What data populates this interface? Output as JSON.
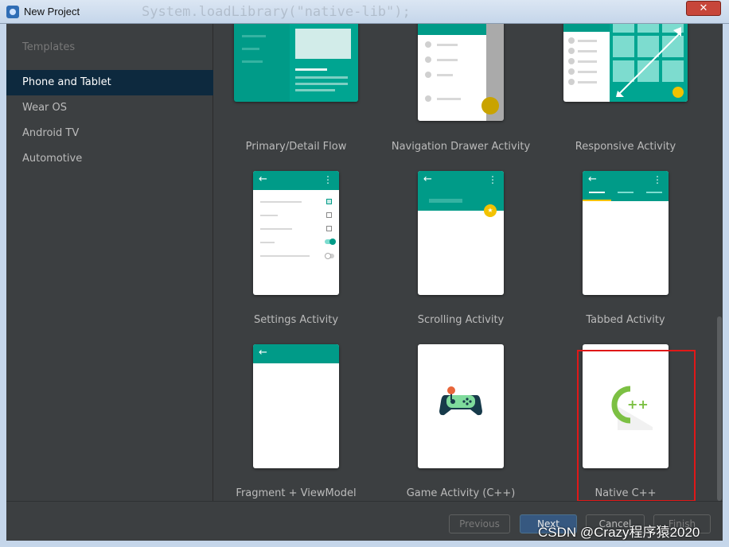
{
  "window": {
    "title": "New Project",
    "background_code_text": "System.loadLibrary(\"native-lib\");",
    "close_glyph": "✕"
  },
  "sidebar": {
    "heading": "Templates",
    "items": [
      {
        "label": "Phone and Tablet",
        "selected": true
      },
      {
        "label": "Wear OS",
        "selected": false
      },
      {
        "label": "Android TV",
        "selected": false
      },
      {
        "label": "Automotive",
        "selected": false
      }
    ]
  },
  "templates": [
    {
      "label": "Primary/Detail Flow"
    },
    {
      "label": "Navigation Drawer Activity"
    },
    {
      "label": "Responsive Activity"
    },
    {
      "label": "Settings Activity"
    },
    {
      "label": "Scrolling Activity"
    },
    {
      "label": "Tabbed Activity"
    },
    {
      "label": "Fragment + ViewModel"
    },
    {
      "label": "Game Activity (C++)"
    },
    {
      "label": "Native C++",
      "highlighted": true,
      "logo_text": "++"
    }
  ],
  "buttons": {
    "previous": "Previous",
    "next": "Next",
    "cancel": "Cancel",
    "finish": "Finish"
  },
  "watermark": "CSDN @Crazy程序猿2020",
  "colors": {
    "accent_teal": "#009b88",
    "fab_yellow": "#f2c200",
    "selection_bg": "#0d293e",
    "highlight_red": "#e01818",
    "cpp_green": "#7cc043"
  }
}
